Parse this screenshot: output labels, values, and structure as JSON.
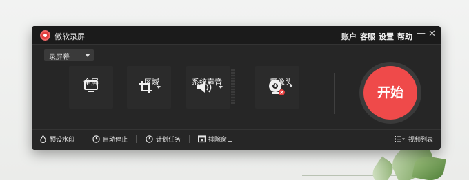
{
  "window": {
    "title": "傲软录屏",
    "menu": [
      "账户",
      "客服",
      "设置",
      "帮助"
    ],
    "minimize_glyph": "—",
    "close_glyph": "✕"
  },
  "mode_select": {
    "selected": "录屏幕"
  },
  "tools": [
    {
      "label": "全屏",
      "icon": "monitor-icon",
      "has_dropdown": false
    },
    {
      "label": "区域",
      "icon": "crop-icon",
      "has_dropdown": true
    },
    {
      "label": "系统声音",
      "icon": "speaker-icon",
      "has_dropdown": true
    },
    {
      "label": "摄像头",
      "icon": "webcam-icon",
      "has_dropdown": true,
      "disabled_badge": true
    }
  ],
  "start_button": {
    "label": "开始",
    "color": "#ef4a4a"
  },
  "bottom_bar": {
    "items": [
      {
        "label": "预设水印",
        "icon": "watermark-drop-icon"
      },
      {
        "label": "自动停止",
        "icon": "auto-stop-clock-icon"
      },
      {
        "label": "计划任务",
        "icon": "schedule-clock-icon"
      },
      {
        "label": "排除窗口",
        "icon": "exclude-window-icon"
      }
    ],
    "video_list": {
      "label": "视频列表",
      "icon": "list-icon"
    }
  },
  "colors": {
    "accent": "#ef4a4a",
    "window_bg": "#262626",
    "titlebar_bg": "#1b1b1b"
  }
}
